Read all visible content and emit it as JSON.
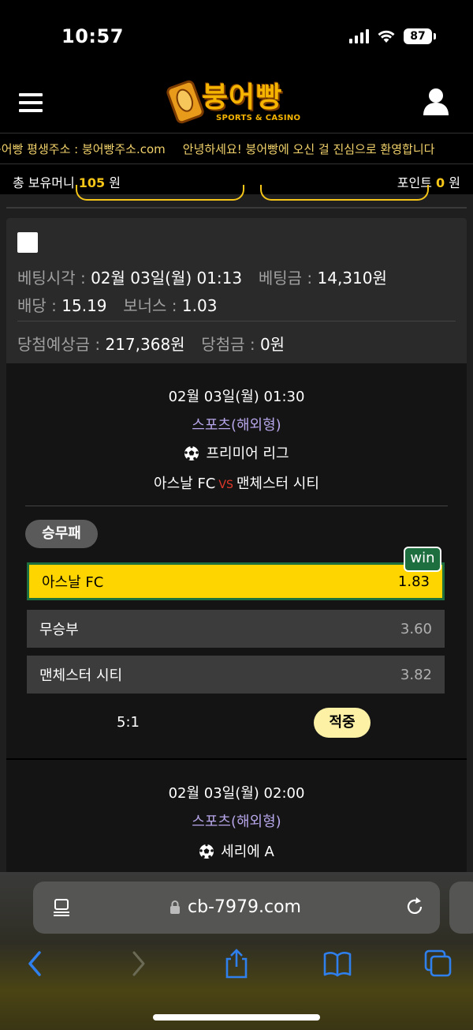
{
  "status_bar": {
    "time": "10:57",
    "battery": "87"
  },
  "header": {
    "logo_text": "붕어빵",
    "logo_sub": "SPORTS & CASINO"
  },
  "marquee": {
    "items": [
      "붕어빵 평생주소 : 붕어빵주소.com",
      "안녕하세요! 붕어빵에 오신 걸 진심으로 환영합니다"
    ]
  },
  "balance": {
    "money_label": "총 보유머니",
    "money_value": "105",
    "money_unit": "원",
    "point_label": "포인트",
    "point_value": "0",
    "point_unit": "원"
  },
  "bet": {
    "time_label": "베팅시각 :",
    "time_value": "02월 03일(월) 01:13",
    "amount_label": "베팅금 :",
    "amount_value": "14,310원",
    "odds_label": "배당 :",
    "odds_value": "15.19",
    "bonus_label": "보너스 :",
    "bonus_value": "1.03",
    "expected_label": "당첨예상금 :",
    "expected_value": "217,368원",
    "won_label": "당첨금 :",
    "won_value": "0원"
  },
  "matches": [
    {
      "datetime": "02월 03일(월) 01:30",
      "category": "스포츠(해외형)",
      "league": "프리미어 리그",
      "home": "아스날 FC",
      "vs": "VS",
      "away": "맨체스터 시티",
      "market": "승무패",
      "win_badge": "win",
      "options": [
        {
          "name": "아스날 FC",
          "odds": "1.83",
          "selected": true
        },
        {
          "name": "무승부",
          "odds": "3.60"
        },
        {
          "name": "맨체스터 시티",
          "odds": "3.82"
        }
      ],
      "score": "5:1",
      "result": "적중"
    },
    {
      "datetime": "02월 03일(월) 02:00",
      "category": "스포츠(해외형)",
      "league": "세리에 A"
    }
  ],
  "browser": {
    "url": "cb-7979.com"
  },
  "colors": {
    "accent": "#ffd500",
    "win_green": "#1e6f3f",
    "category": "#b7a6ea"
  }
}
